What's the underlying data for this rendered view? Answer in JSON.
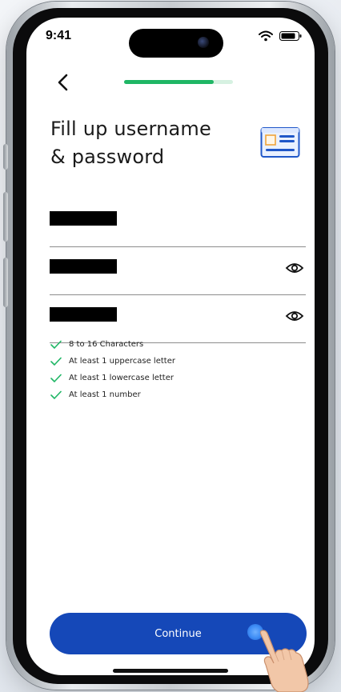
{
  "status_bar": {
    "time": "9:41"
  },
  "header": {
    "progress_value": 0.82
  },
  "page": {
    "title_line1": "Fill up username",
    "title_line2": "& password"
  },
  "fields": [
    {
      "type": "username",
      "has_toggle": false
    },
    {
      "type": "password",
      "has_toggle": true
    },
    {
      "type": "confirm-password",
      "has_toggle": true
    }
  ],
  "password_rules": [
    {
      "label": "8 to 16 Characters"
    },
    {
      "label": "At least 1 uppercase letter"
    },
    {
      "label": "At least 1 lowercase letter"
    },
    {
      "label": "At least 1 number"
    }
  ],
  "actions": {
    "continue_label": "Continue"
  },
  "colors": {
    "primary": "#1548b8",
    "success": "#1fb665",
    "progress_track": "#d6f1e1",
    "card_icon_blue": "#1f57c8",
    "card_icon_orange": "#f0a43a"
  },
  "icons": {
    "back": "chevron-left-icon",
    "card": "id-card-icon",
    "eye": "eye-icon",
    "check": "check-icon",
    "wifi": "wifi-icon",
    "battery": "battery-icon"
  }
}
